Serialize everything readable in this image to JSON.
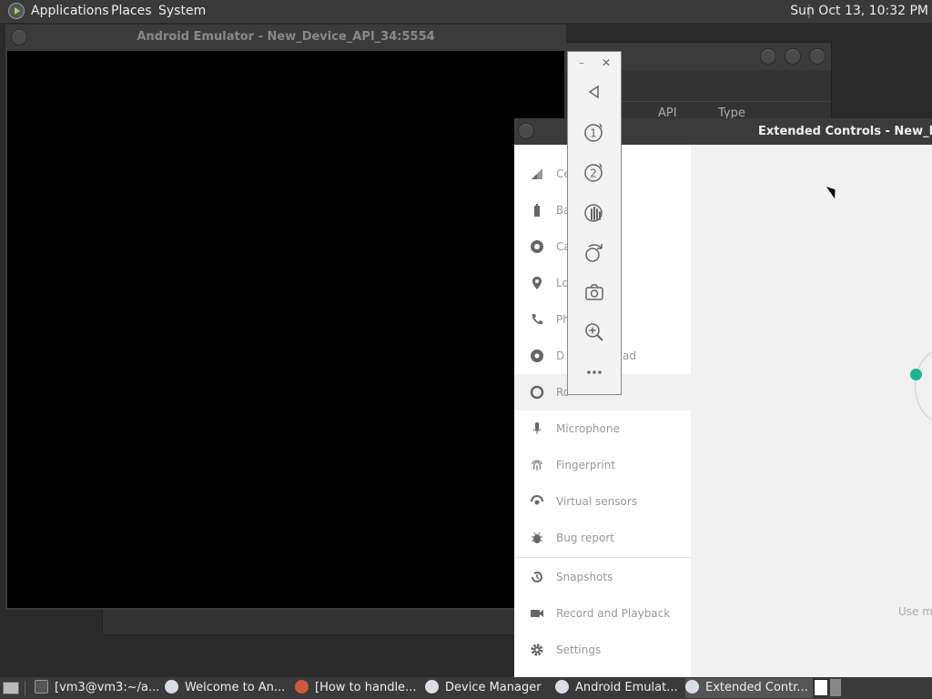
{
  "topbar": {
    "menus": [
      "Applications",
      "Places",
      "System"
    ],
    "clock": "Sun Oct 13, 10:32 PM"
  },
  "emulator": {
    "title": "Android Emulator - New_Device_API_34:5554"
  },
  "device_manager": {
    "col_api": "API",
    "col_type": "Type"
  },
  "extended": {
    "title": "Extended Controls - New_Devic",
    "nav": [
      {
        "label": "Ce",
        "icon": "cellular-icon"
      },
      {
        "label": "Ba",
        "icon": "battery-icon"
      },
      {
        "label": "Ca",
        "icon": "camera-icon"
      },
      {
        "label": "Lo",
        "icon": "location-icon"
      },
      {
        "label": "Ph",
        "icon": "phone-icon"
      },
      {
        "label": "D",
        "label2": "ad",
        "icon": "directional-pad-icon"
      },
      {
        "label": "Ro",
        "icon": "rotary-icon"
      },
      {
        "label": "Microphone",
        "icon": "microphone-icon"
      },
      {
        "label": "Fingerprint",
        "icon": "fingerprint-icon"
      },
      {
        "label": "Virtual sensors",
        "icon": "virtual-sensors-icon"
      },
      {
        "label": "Bug report",
        "icon": "bug-icon"
      },
      {
        "label": "Snapshots",
        "icon": "history-icon"
      },
      {
        "label": "Record and Playback",
        "icon": "video-camera-icon"
      },
      {
        "label": "Settings",
        "icon": "gear-icon"
      }
    ],
    "content_hint": "Use m"
  },
  "toolbar": {
    "minimize": "–",
    "close": "✕"
  },
  "taskbar": {
    "tasks": [
      {
        "label": "[vm3@vm3:~/a..."
      },
      {
        "label": "Welcome to An..."
      },
      {
        "label": "[How to handle..."
      },
      {
        "label": "Device Manager"
      },
      {
        "label": "Android Emulat..."
      },
      {
        "label": "Extended Contr..."
      }
    ]
  }
}
